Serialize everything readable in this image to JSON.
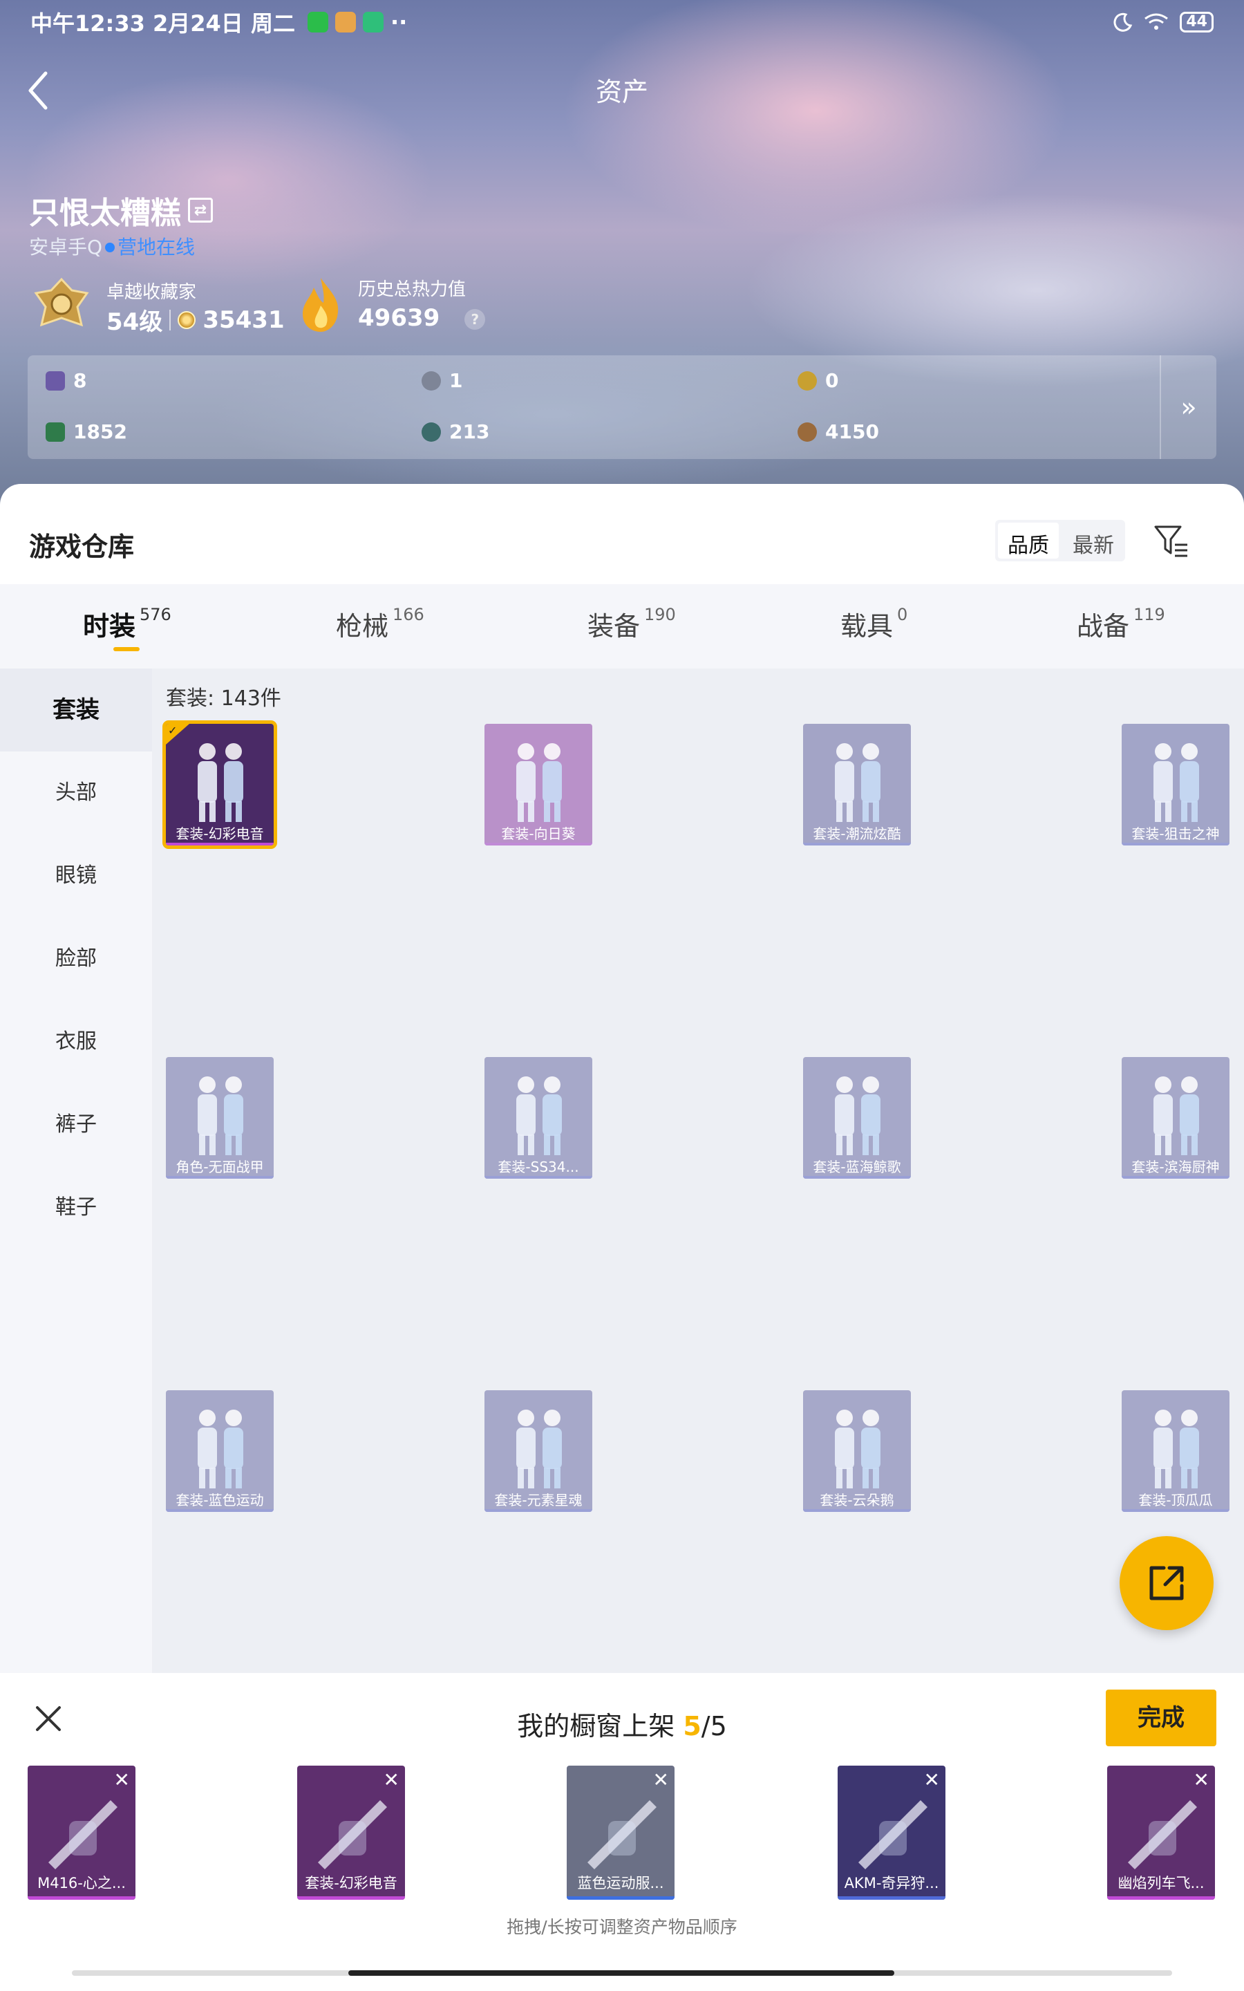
{
  "status_bar": {
    "time": "中午12:33 2月24日 周二",
    "dots": "··",
    "battery": "44"
  },
  "header": {
    "title": "资产"
  },
  "profile": {
    "name": "只恨太糟糕",
    "platform": "安卓手Q",
    "camp_status": "营地在线",
    "level_label": "卓越收藏家",
    "level": "54级",
    "coins": "35431",
    "heat_label": "历史总热力值",
    "heat": "49639",
    "help": "?"
  },
  "stats": [
    {
      "value": "8",
      "color": "#6b5aa6"
    },
    {
      "value": "1",
      "color": "#7e8597"
    },
    {
      "value": "0",
      "color": "#c8a030"
    },
    {
      "value": "1852",
      "color": "#2f7b4a"
    },
    {
      "value": "213",
      "color": "#3b6b6b"
    },
    {
      "value": "4150",
      "color": "#9a6a3b"
    }
  ],
  "stats_more": "»",
  "warehouse": {
    "title": "游戏仓库",
    "sort": [
      "品质",
      "最新"
    ],
    "tabs": [
      {
        "label": "时装",
        "count": "576"
      },
      {
        "label": "枪械",
        "count": "166"
      },
      {
        "label": "装备",
        "count": "190"
      },
      {
        "label": "载具",
        "count": "0"
      },
      {
        "label": "战备",
        "count": "119"
      }
    ],
    "sidebar": [
      "套装",
      "头部",
      "眼镜",
      "脸部",
      "衣服",
      "裤子",
      "鞋子"
    ],
    "count_label": "套装: 143件",
    "items": [
      {
        "label": "套装-幻彩电音",
        "color": "#4a2a66",
        "bar": "#c04ad6"
      },
      {
        "label": "套装-向日葵",
        "color": "#b991c9",
        "bar": "#c08ad6"
      },
      {
        "label": "套装-潮流炫酷",
        "color": "#a3a4c6",
        "bar": "#9aa0d6"
      },
      {
        "label": "套装-狙击之神",
        "color": "#a2a5c8",
        "bar": "#9aa0d6"
      },
      {
        "label": "角色-无面战甲",
        "color": "#a6a8c9",
        "bar": "#9aa0d6"
      },
      {
        "label": "套装-SS34...",
        "color": "#a6a8c9",
        "bar": "#9aa0d6"
      },
      {
        "label": "套装-蓝海鲸歌",
        "color": "#a6a8c9",
        "bar": "#9aa0d6"
      },
      {
        "label": "套装-滨海厨神",
        "color": "#a6a8c9",
        "bar": "#9aa0d6"
      },
      {
        "label": "套装-蓝色运动",
        "color": "#a6a8c9",
        "bar": "#9aa0d6"
      },
      {
        "label": "套装-元素星魂",
        "color": "#a6a8c9",
        "bar": "#9aa0d6"
      },
      {
        "label": "套装-云朵鹅",
        "color": "#a6a8c9",
        "bar": "#9aa0d6"
      },
      {
        "label": "套装-顶瓜瓜",
        "color": "#a6a8c9",
        "bar": "#9aa0d6"
      }
    ]
  },
  "showcase": {
    "title": "我的橱窗上架 ",
    "filled": "5",
    "total": "/5",
    "done": "完成",
    "hint": "拖拽/长按可调整资产物品顺序",
    "slots": [
      {
        "label": "M416-心之...",
        "color": "#5e2f6e",
        "bar": "#c04ad6"
      },
      {
        "label": "套装-幻彩电音",
        "color": "#5e2f6e",
        "bar": "#c04ad6"
      },
      {
        "label": "蓝色运动服...",
        "color": "#6b7086",
        "bar": "#3e6fe0"
      },
      {
        "label": "AKM-奇异狩...",
        "color": "#3d3670",
        "bar": "#4f6ad8"
      },
      {
        "label": "幽焰列车飞...",
        "color": "#5e2f6e",
        "bar": "#c04ad6"
      }
    ]
  }
}
